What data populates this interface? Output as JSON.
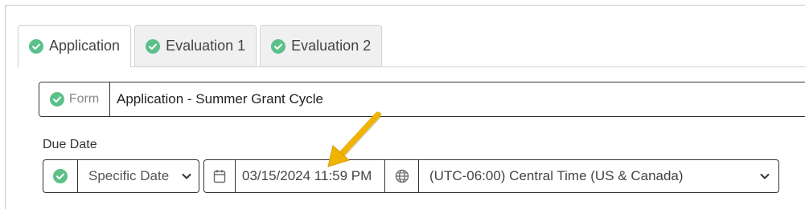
{
  "tabs": [
    {
      "label": "Application",
      "active": true,
      "icon": "check-circle-icon"
    },
    {
      "label": "Evaluation 1",
      "active": false,
      "icon": "check-circle-icon"
    },
    {
      "label": "Evaluation 2",
      "active": false,
      "icon": "check-circle-icon"
    }
  ],
  "form": {
    "label": "Form",
    "value": "Application - Summer Grant Cycle"
  },
  "due_date": {
    "label": "Due Date",
    "mode_selected": "Specific Date",
    "date_value": "03/15/2024 11:59 PM",
    "timezone_selected": "(UTC-06:00) Central Time (US & Canada)"
  },
  "colors": {
    "check_green": "#5cc08a",
    "arrow": "#f0b400",
    "border": "#333333"
  },
  "icons": {
    "calendar": "calendar-icon",
    "globe": "globe-icon",
    "chevron": "chevron-down-icon"
  }
}
